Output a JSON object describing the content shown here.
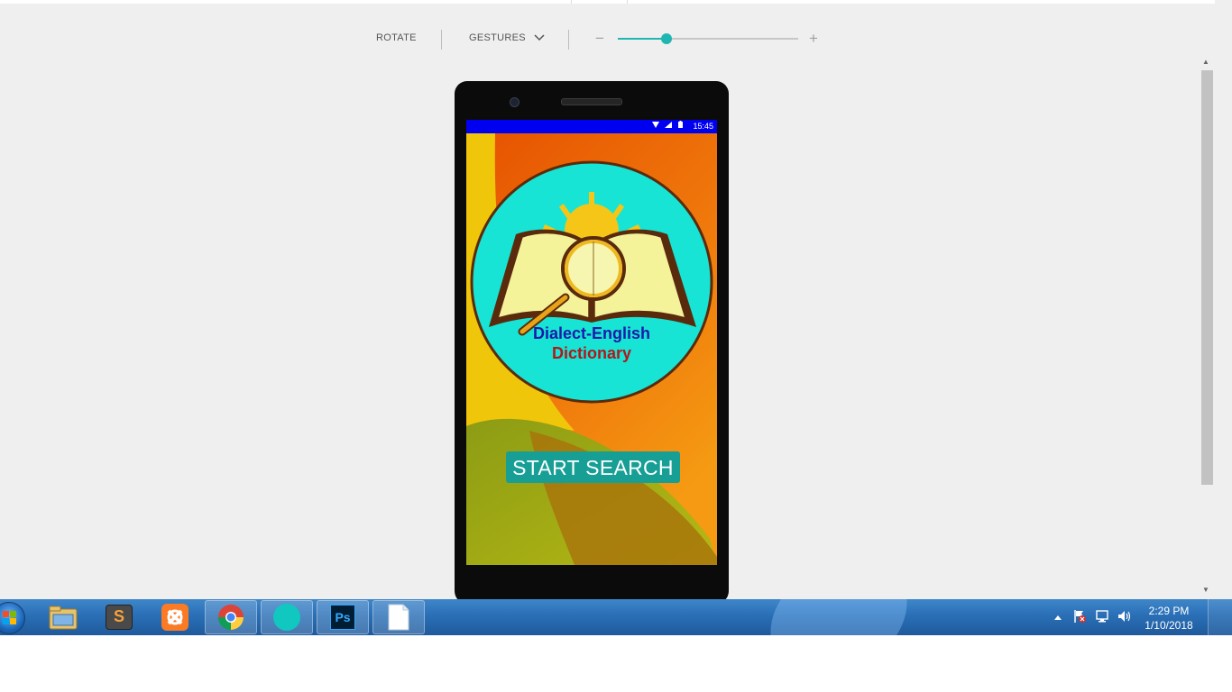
{
  "toolbar": {
    "rotate_label": "ROTATE",
    "gestures_label": "GESTURES",
    "zoom_minus": "−",
    "zoom_plus": "+",
    "zoom_level": 0.27,
    "accent": "#1fb6b1"
  },
  "device": {
    "status_time": "15:45",
    "status_icons": [
      "wifi-icon",
      "signal-icon",
      "battery-icon"
    ],
    "statusbar_color": "#0000f0"
  },
  "app": {
    "logo_title_line1": "Dialect-English",
    "logo_title_line2": "Dictionary",
    "start_button_label": "START SEARCH",
    "button_color": "#179e95"
  },
  "taskbar": {
    "apps": [
      "file-explorer-icon",
      "sublime-text-icon",
      "xampp-icon",
      "chrome-icon",
      "teal-circle-app-icon",
      "photoshop-icon",
      "blank-document-icon"
    ],
    "photoshop_label": "Ps",
    "sublime_label": "S",
    "tray_icons": [
      "show-hidden-icons-icon",
      "action-center-flag-icon",
      "network-icon",
      "volume-icon"
    ],
    "clock_time": "2:29 PM",
    "clock_date": "1/10/2018"
  }
}
